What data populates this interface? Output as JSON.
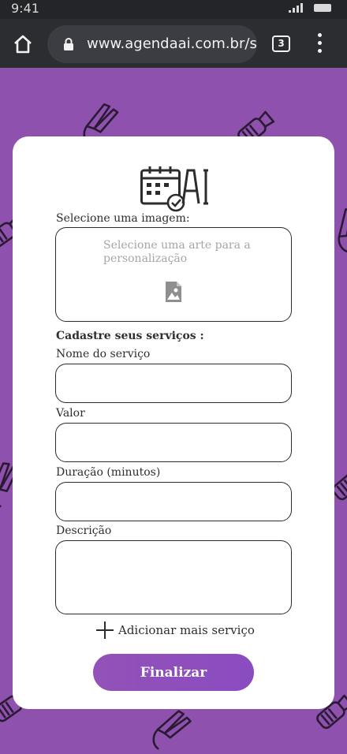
{
  "status_bar": {
    "time": "9:41"
  },
  "browser": {
    "url": "www.agendaai.com.br/st",
    "tab_count": "3"
  },
  "form": {
    "image_label": "Selecione uma imagem:",
    "image_placeholder": "Selecione uma arte para a personalização",
    "services_heading": "Cadastre seus serviços :",
    "service_name_label": "Nome do serviço",
    "price_label": "Valor",
    "duration_label": "Duração (minutos)",
    "description_label": "Descrição",
    "add_service_label": "Adicionar mais serviço",
    "finalize_label": "Finalizar"
  },
  "colors": {
    "background": "#8e51ad",
    "button": "#9352b7",
    "browser_bar": "#2b2d31",
    "status_bar": "#232528"
  },
  "icons": [
    "home-icon",
    "lock-icon",
    "tabs-icon",
    "menu-icon",
    "logo-calendar-icon",
    "image-icon",
    "plus-icon"
  ]
}
